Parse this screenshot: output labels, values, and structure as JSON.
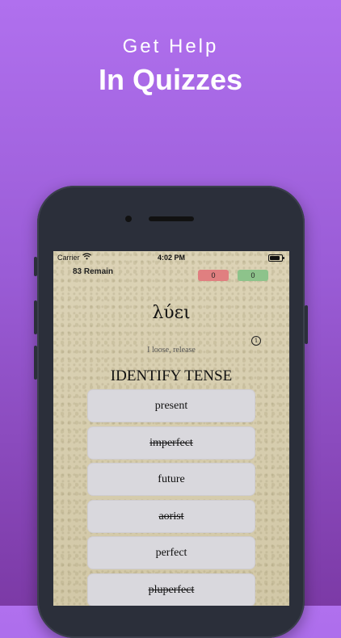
{
  "promo": {
    "subtitle": "Get Help",
    "title": "In Quizzes"
  },
  "status_bar": {
    "carrier": "Carrier",
    "time": "4:02 PM"
  },
  "quiz": {
    "remaining": "83 Remain",
    "wrong_count": "0",
    "right_count": "0",
    "word": "λύει",
    "info_icon": "i",
    "meaning": "I loose, release",
    "prompt": "IDENTIFY TENSE",
    "options": [
      {
        "label": "present",
        "struck": false
      },
      {
        "label": "imperfect",
        "struck": true
      },
      {
        "label": "future",
        "struck": false
      },
      {
        "label": "aorist",
        "struck": true
      },
      {
        "label": "perfect",
        "struck": false
      },
      {
        "label": "pluperfect",
        "struck": true
      }
    ]
  },
  "colors": {
    "background_top": "#b070ee",
    "wrong_badge": "#e07f80",
    "right_badge": "#8dc38b",
    "option_bg": "#d9d8dd"
  },
  "icons": [
    "wifi-icon",
    "battery-icon",
    "info-icon"
  ]
}
